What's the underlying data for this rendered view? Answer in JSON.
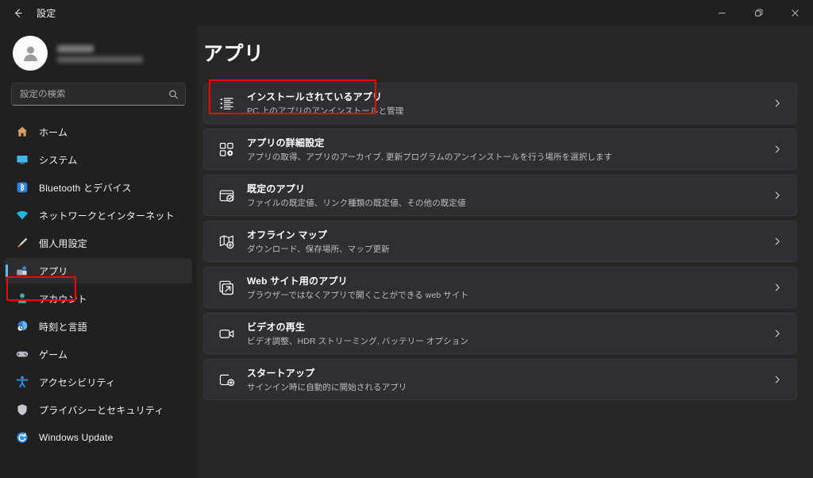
{
  "window": {
    "titlebar_title": "設定",
    "back_icon": "arrow-left-icon",
    "controls": [
      {
        "name": "minimize",
        "glyph": "minimize-icon"
      },
      {
        "name": "maximize",
        "glyph": "restore-icon"
      },
      {
        "name": "close",
        "glyph": "close-icon"
      }
    ]
  },
  "colors": {
    "accent": "#4cc2ff",
    "annotation": "#ff0000",
    "sidebar_bg": "#202020",
    "main_bg": "#272727",
    "card_bg": "#2f2f33"
  },
  "sidebar": {
    "account": {
      "avatar_icon": "person-avatar-icon",
      "name": "",
      "email": "",
      "redacted": true
    },
    "search": {
      "placeholder": "設定の検索",
      "value": "",
      "icon": "search-icon"
    },
    "items": [
      {
        "label": "ホーム",
        "icon": "home-icon",
        "selected": false
      },
      {
        "label": "システム",
        "icon": "system-monitor-icon",
        "selected": false
      },
      {
        "label": "Bluetooth とデバイス",
        "icon": "bluetooth-icon",
        "selected": false
      },
      {
        "label": "ネットワークとインターネット",
        "icon": "wifi-icon",
        "selected": false
      },
      {
        "label": "個人用設定",
        "icon": "paintbrush-icon",
        "selected": false
      },
      {
        "label": "アプリ",
        "icon": "apps-icon",
        "selected": true
      },
      {
        "label": "アカウント",
        "icon": "account-person-icon",
        "selected": false
      },
      {
        "label": "時刻と言語",
        "icon": "clock-language-icon",
        "selected": false
      },
      {
        "label": "ゲーム",
        "icon": "gamepad-icon",
        "selected": false
      },
      {
        "label": "アクセシビリティ",
        "icon": "accessibility-icon",
        "selected": false
      },
      {
        "label": "プライバシーとセキュリティ",
        "icon": "shield-icon",
        "selected": false
      },
      {
        "label": "Windows Update",
        "icon": "windows-update-icon",
        "selected": false
      }
    ]
  },
  "main": {
    "page_title": "アプリ",
    "cards": [
      {
        "title": "インストールされているアプリ",
        "subtitle": "PC 上のアプリのアンインストールと管理",
        "icon": "installed-apps-list-icon",
        "chevron": "chevron-right-icon",
        "highlighted": true
      },
      {
        "title": "アプリの詳細設定",
        "subtitle": "アプリの取得、アプリのアーカイブ, 更新プログラムのアンインストールを行う場所を選択します",
        "icon": "advanced-app-settings-icon",
        "chevron": "chevron-right-icon",
        "highlighted": false
      },
      {
        "title": "既定のアプリ",
        "subtitle": "ファイルの既定値、リンク種類の既定値、その他の既定値",
        "icon": "default-apps-check-icon",
        "chevron": "chevron-right-icon",
        "highlighted": false
      },
      {
        "title": "オフライン マップ",
        "subtitle": "ダウンロード、保存場所、マップ更新",
        "icon": "offline-maps-icon",
        "chevron": "chevron-right-icon",
        "highlighted": false
      },
      {
        "title": "Web サイト用のアプリ",
        "subtitle": "ブラウザーではなくアプリで開くことができる web サイト",
        "icon": "apps-for-websites-icon",
        "chevron": "chevron-right-icon",
        "highlighted": false
      },
      {
        "title": "ビデオの再生",
        "subtitle": "ビデオ調整、HDR ストリーミング, バッテリー オプション",
        "icon": "video-playback-icon",
        "chevron": "chevron-right-icon",
        "highlighted": false
      },
      {
        "title": "スタートアップ",
        "subtitle": "サインイン時に自動的に開始されるアプリ",
        "icon": "startup-apps-icon",
        "chevron": "chevron-right-icon",
        "highlighted": false
      }
    ]
  },
  "annotations": [
    {
      "name": "sidebar-apps-highlight",
      "target": "アプリ"
    },
    {
      "name": "installed-apps-highlight",
      "target": "インストールされているアプリ"
    }
  ]
}
